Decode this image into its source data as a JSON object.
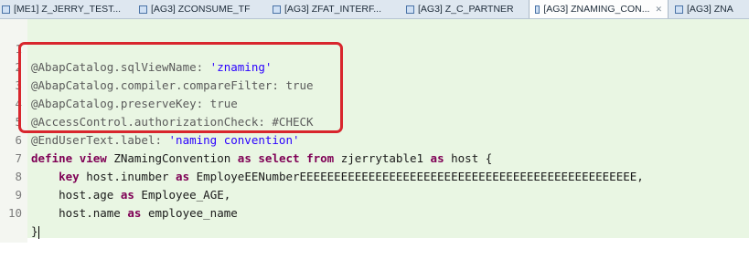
{
  "tabs": [
    {
      "label": "[ME1] Z_JERRY_TEST...",
      "icon": "abap-object-icon"
    },
    {
      "label": "[AG3] ZCONSUME_TF",
      "icon": "abap-object-icon"
    },
    {
      "label": "[AG3] ZFAT_INTERF...",
      "icon": "abap-object-icon"
    },
    {
      "label": "[AG3] Z_C_PARTNER",
      "icon": "abap-object-icon"
    },
    {
      "label": "[AG3] ZNAMING_CON...",
      "icon": "abap-object-icon",
      "active": true,
      "close": "✕"
    },
    {
      "label": "[AG3] ZNA",
      "icon": "abap-object-icon"
    }
  ],
  "editor": {
    "lines": [
      {
        "num": "1",
        "parts": [
          "@AbapCatalog.sqlViewName: ",
          "'znaming'"
        ]
      },
      {
        "num": "2",
        "parts": [
          "@AbapCatalog.compiler.compareFilter: true"
        ]
      },
      {
        "num": "3",
        "parts": [
          "@AbapCatalog.preserveKey: true"
        ]
      },
      {
        "num": "4",
        "parts": [
          "@AccessControl.authorizationCheck: #CHECK"
        ]
      },
      {
        "num": "5",
        "parts": [
          "@EndUserText.label: ",
          "'naming convention'"
        ]
      },
      {
        "num": "6",
        "parts": [
          "define",
          " ",
          "view",
          " ZNamingConvention ",
          "as",
          " ",
          "select",
          " ",
          "from",
          " zjerrytable1 ",
          "as",
          " host {"
        ]
      },
      {
        "num": "7",
        "parts": [
          "    ",
          "key",
          " host.inumber ",
          "as",
          " EmployeEENumberEEEEEEEEEEEEEEEEEEEEEEEEEEEEEEEEEEEEEEEEEEEEEEEEE,"
        ]
      },
      {
        "num": "8",
        "parts": [
          "    host.age ",
          "as",
          " Employee_AGE,"
        ]
      },
      {
        "num": "9",
        "parts": [
          "    host.name ",
          "as",
          " employee_name"
        ]
      },
      {
        "num": "10",
        "parts": [
          "}"
        ]
      }
    ]
  },
  "colors": {
    "keyword": "#7f0055",
    "string": "#2a00ff",
    "annotation": "#5b5b5b",
    "highlight_box": "#d8262d",
    "code_background": "#e9f6e3"
  }
}
